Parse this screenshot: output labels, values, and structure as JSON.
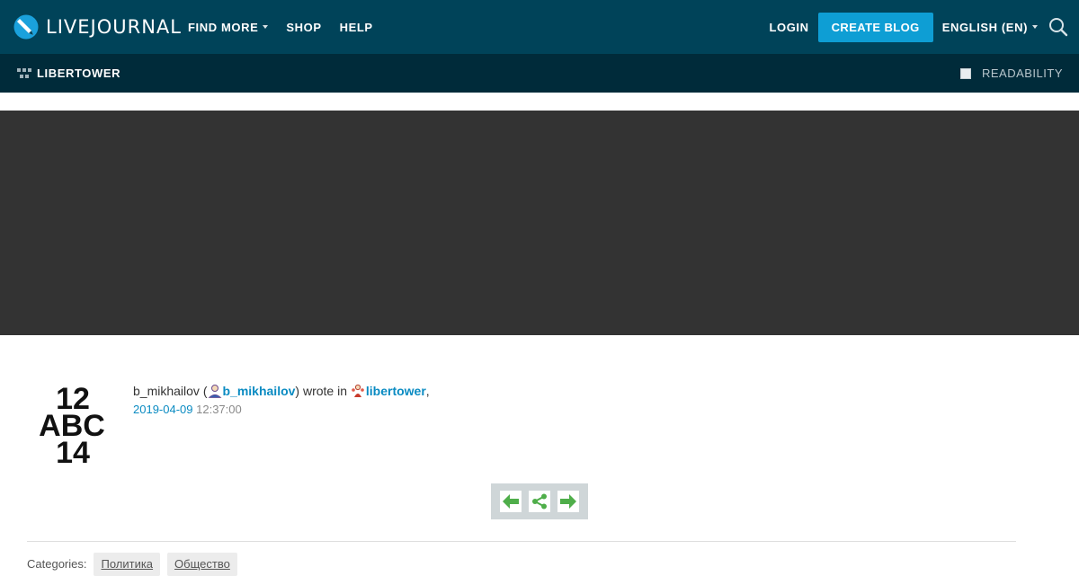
{
  "header": {
    "logo_text": "LIVEJOURNAL",
    "nav": [
      {
        "label": "FIND MORE"
      },
      {
        "label": "SHOP"
      },
      {
        "label": "HELP"
      }
    ],
    "login_label": "LOGIN",
    "create_blog_label": "CREATE BLOG",
    "language_label": "ENGLISH (EN)",
    "search_icon": "search-icon"
  },
  "journal_bar": {
    "journal_name": "LIBERTOWER",
    "readability_label": "READABILITY"
  },
  "post": {
    "author_name": "b_mikhailov",
    "paren_open": " (",
    "author_link": "b_mikhailov",
    "wrote_in": ") wrote in ",
    "community_link": "libertower",
    "comma": ",",
    "date": "2019-04-09",
    "time": "12:37:00",
    "userpic_lines": [
      "12",
      "ABC",
      "14"
    ]
  },
  "entry_nav": {
    "prev_icon": "arrow-left-icon",
    "share_icon": "share-icon",
    "next_icon": "arrow-right-icon"
  },
  "categories": {
    "label": "Categories:",
    "tags": [
      "Политика",
      "Общество"
    ]
  },
  "colors": {
    "header_bg": "#004359",
    "journal_bar_bg": "#002b3a",
    "accent": "#0e9ed4",
    "link": "#0a8bc2",
    "banner_bg": "#333333",
    "nav_green": "#4fae4a"
  }
}
